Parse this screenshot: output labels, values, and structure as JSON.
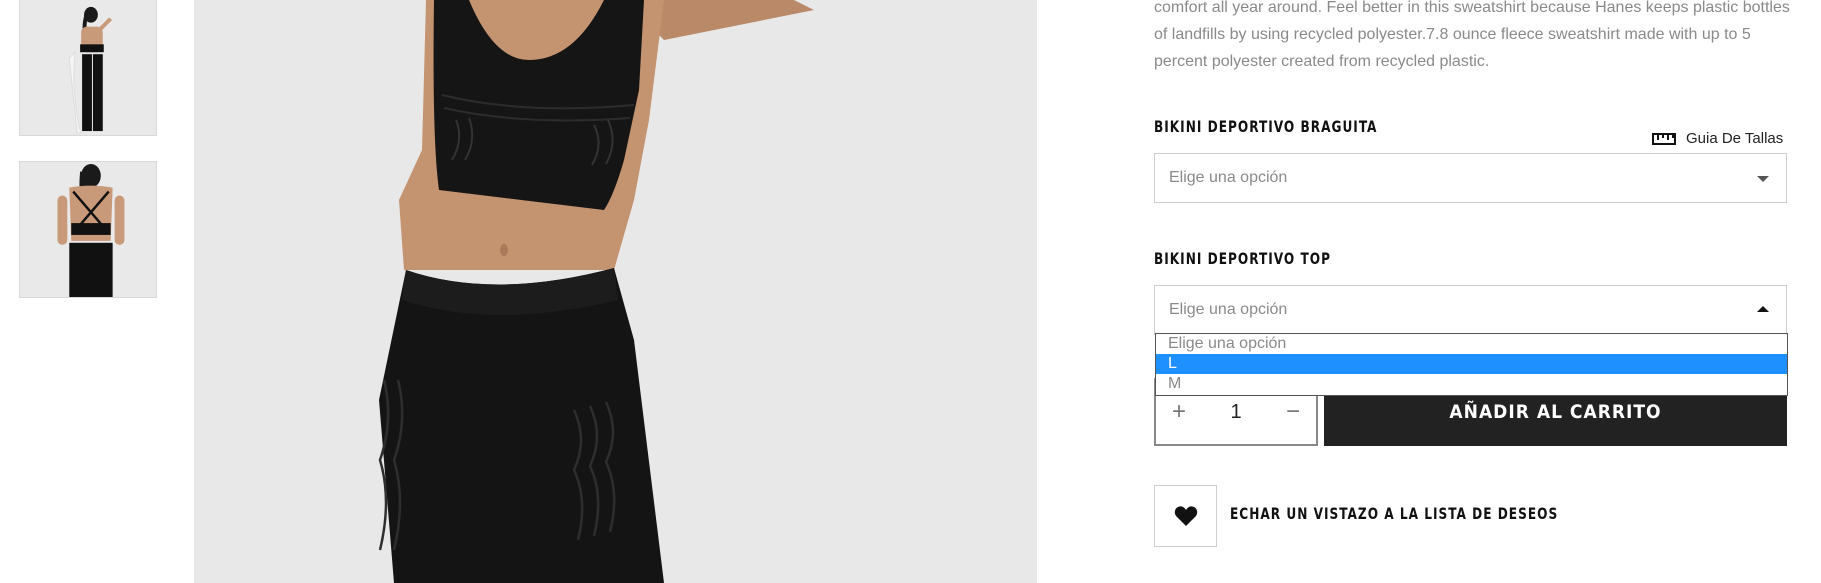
{
  "description": {
    "text": "comfort all year around. Feel better in this sweatshirt because Hanes keeps plastic bottles of landfills by using recycled polyester.7.8 ounce fleece sweatshirt made with up to 5 percent polyester created from recycled plastic."
  },
  "size_guide": {
    "label": "Guia De Tallas",
    "icon": "ruler-icon"
  },
  "attributes": [
    {
      "label": "BIKINI DEPORTIVO BRAGUITA",
      "placeholder": "Elige una opción",
      "open": false
    },
    {
      "label": "BIKINI DEPORTIVO TOP",
      "placeholder": "Elige una opción",
      "open": true
    }
  ],
  "dropdown": {
    "options": [
      "Elige una opción",
      "L",
      "M"
    ],
    "highlighted": "L",
    "highlight_color": "#1e90ff"
  },
  "quantity": {
    "minus": "−",
    "plus": "+",
    "value": "1"
  },
  "add_to_cart": {
    "label": "AÑADIR AL CARRITO",
    "color": "#222222"
  },
  "wishlist": {
    "label": "ECHAR UN VISTAZO A LA LISTA DE DESEOS",
    "icon": "heart-icon"
  }
}
